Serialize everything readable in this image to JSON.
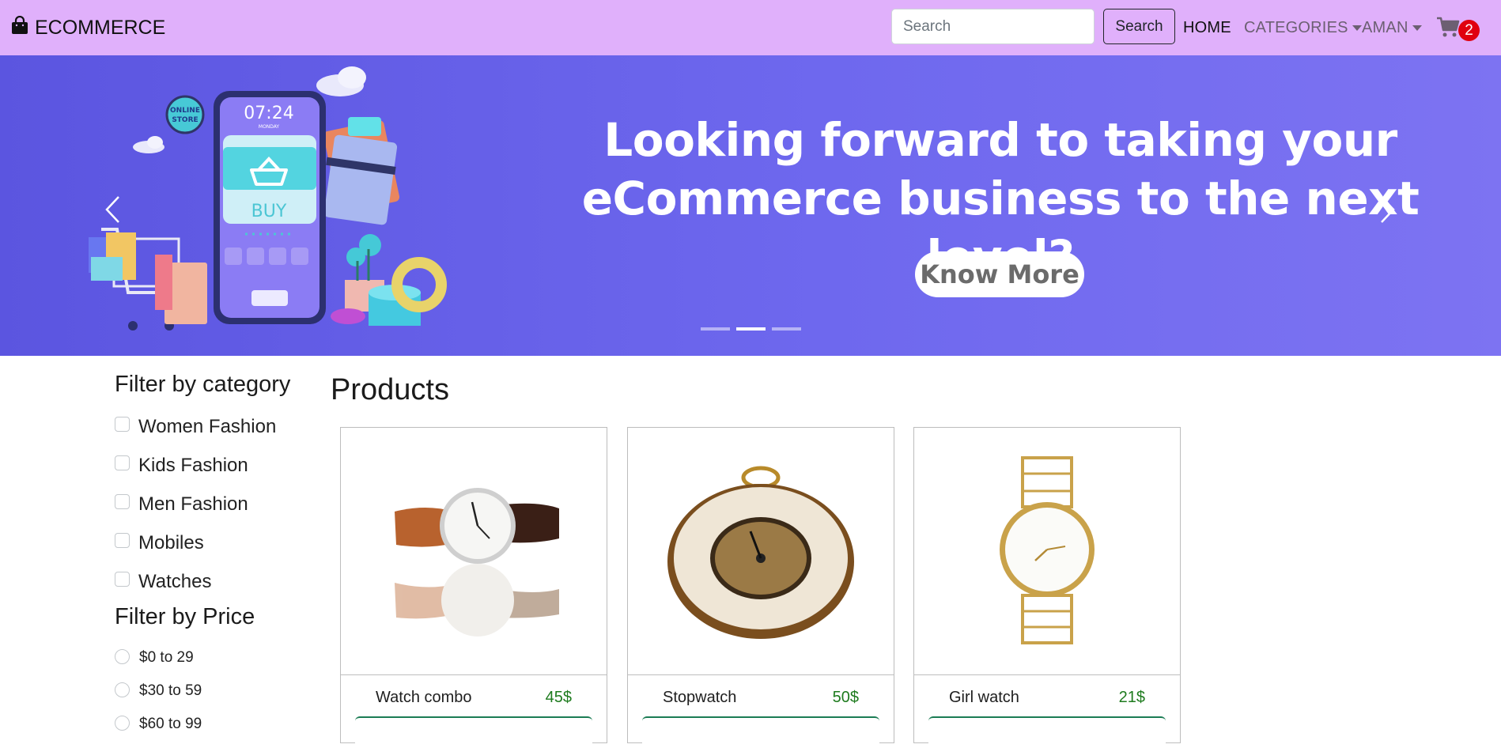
{
  "navbar": {
    "brand_icon": "shopping-bag-icon",
    "brand": "ECOMMERCE",
    "search_placeholder": "Search",
    "search_button": "Search",
    "home": "HOME",
    "categories": "CATEGORIES",
    "user": "AMAN",
    "cart_icon": "cart-icon",
    "cart_count": "2",
    "cart_badge_color": "#e0000f"
  },
  "hero": {
    "headline_line1": "Looking forward to taking your",
    "headline_line2": "eCommerce business to the next level?",
    "cta": "Know More",
    "phone_time": "07:24",
    "phone_day": "MONDAY",
    "phone_buy": "BUY",
    "store_badge_line1": "ONLINE",
    "store_badge_line2": "STORE",
    "active_slide": 2,
    "slide_count": 3
  },
  "sidebar": {
    "category_title": "Filter by category",
    "categories": [
      "Women Fashion",
      "Kids Fashion",
      "Men Fashion",
      "Mobiles",
      "Watches"
    ],
    "price_title": "Filter by Price",
    "prices": [
      "$0 to 29",
      "$30 to 59",
      "$60 to 99"
    ]
  },
  "main": {
    "title": "Products",
    "products": [
      {
        "name": "Watch combo",
        "price": "45$",
        "image_icon": "wrist-watch-image"
      },
      {
        "name": "Stopwatch",
        "price": "50$",
        "image_icon": "pocket-watch-image"
      },
      {
        "name": "Girl watch",
        "price": "21$",
        "image_icon": "gold-watch-image"
      }
    ]
  },
  "colors": {
    "navbar_bg": "#e0b0fb",
    "hero_bg": "#6a63ea",
    "price_color": "#1e7b1e",
    "button_border": "#1b7c54"
  }
}
